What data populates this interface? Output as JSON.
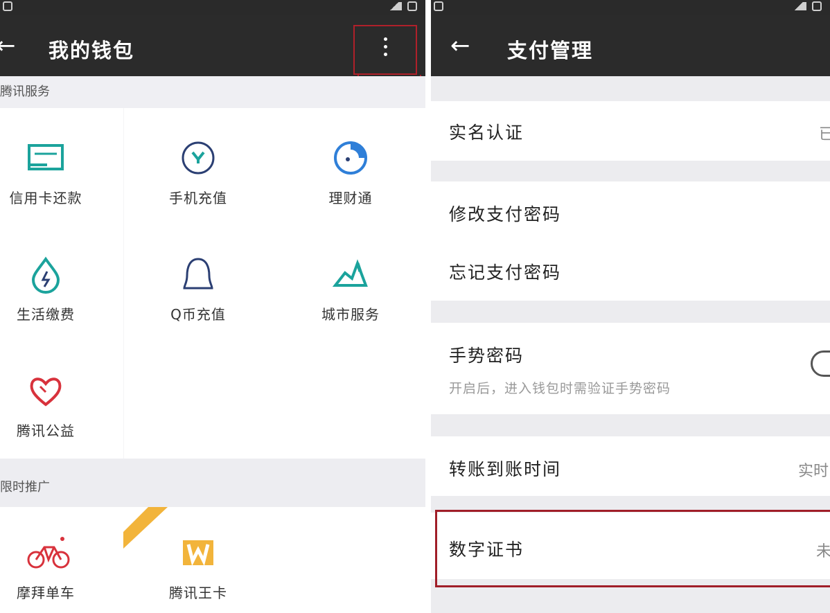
{
  "left": {
    "title": "我的钱包",
    "back_icon": "arrow-left-icon",
    "more_icon": "more-vertical-icon",
    "section1": "腾讯服务",
    "services": [
      {
        "label": "信用卡还款",
        "icon": "credit-card-icon",
        "color": "#1ba39c"
      },
      {
        "label": "手机充值",
        "icon": "phone-recharge-icon",
        "color": "#2b3f73"
      },
      {
        "label": "理财通",
        "icon": "wealth-icon",
        "color": "#2f7fd8"
      },
      {
        "label": "生活缴费",
        "icon": "utility-drop-icon",
        "color": "#1ba39c"
      },
      {
        "label": "Q币充值",
        "icon": "qq-penguin-icon",
        "color": "#2b3f73"
      },
      {
        "label": "城市服务",
        "icon": "city-service-icon",
        "color": "#1ba39c"
      },
      {
        "label": "腾讯公益",
        "icon": "charity-heart-icon",
        "color": "#d8323c"
      }
    ],
    "section2": "限时推广",
    "promos": [
      {
        "label": "摩拜单车",
        "icon": "bike-icon",
        "color": "#d8323c"
      },
      {
        "label": "腾讯王卡",
        "icon": "wangka-icon",
        "color": "#f2b43b"
      }
    ]
  },
  "right": {
    "title": "支付管理",
    "back_icon": "arrow-left-icon",
    "rows": {
      "realname": {
        "label": "实名认证",
        "value": "已"
      },
      "change_pwd": {
        "label": "修改支付密码"
      },
      "forgot_pwd": {
        "label": "忘记支付密码"
      },
      "gesture": {
        "label": "手势密码",
        "sub": "开启后，进入钱包时需验证手势密码"
      },
      "transfer_time": {
        "label": "转账到账时间",
        "value": "实时"
      },
      "certificate": {
        "label": "数字证书",
        "value": "未"
      }
    }
  },
  "colors": {
    "appbar": "#2b2b2b",
    "highlight_red": "#b0202a"
  }
}
